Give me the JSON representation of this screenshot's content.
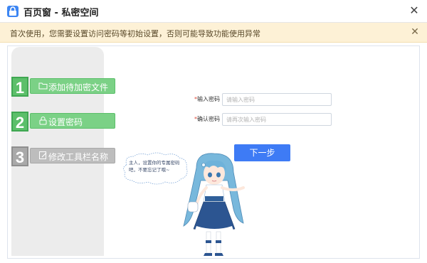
{
  "window": {
    "title": "百页窗 - 私密空间"
  },
  "notice": {
    "text": "首次使用，您需要设置访问密码等初始设置，否则可能导致功能使用异常"
  },
  "steps": [
    {
      "num": "1",
      "label": "添加待加密文件",
      "icon": "folder-icon",
      "state": "active"
    },
    {
      "num": "2",
      "label": "设置密码",
      "icon": "lock-icon",
      "state": "active"
    },
    {
      "num": "3",
      "label": "修改工具栏名称",
      "icon": "edit-icon",
      "state": "inactive"
    }
  ],
  "form": {
    "password": {
      "required_mark": "*",
      "label": "输入密码",
      "placeholder": "请输入密码",
      "value": ""
    },
    "confirm": {
      "required_mark": "*",
      "label": "确认密码",
      "placeholder": "请再次输入密码",
      "value": ""
    },
    "next_label": "下一步"
  },
  "mascot": {
    "speech": "主人，设置你的专属密码吧，不要忘记了哦~"
  },
  "colors": {
    "primary": "#3e7bf5",
    "step_active": "#7bd186",
    "step_inactive": "#bdbdbd",
    "notice_bg": "#fdf1d6",
    "required": "#e04a3a"
  }
}
